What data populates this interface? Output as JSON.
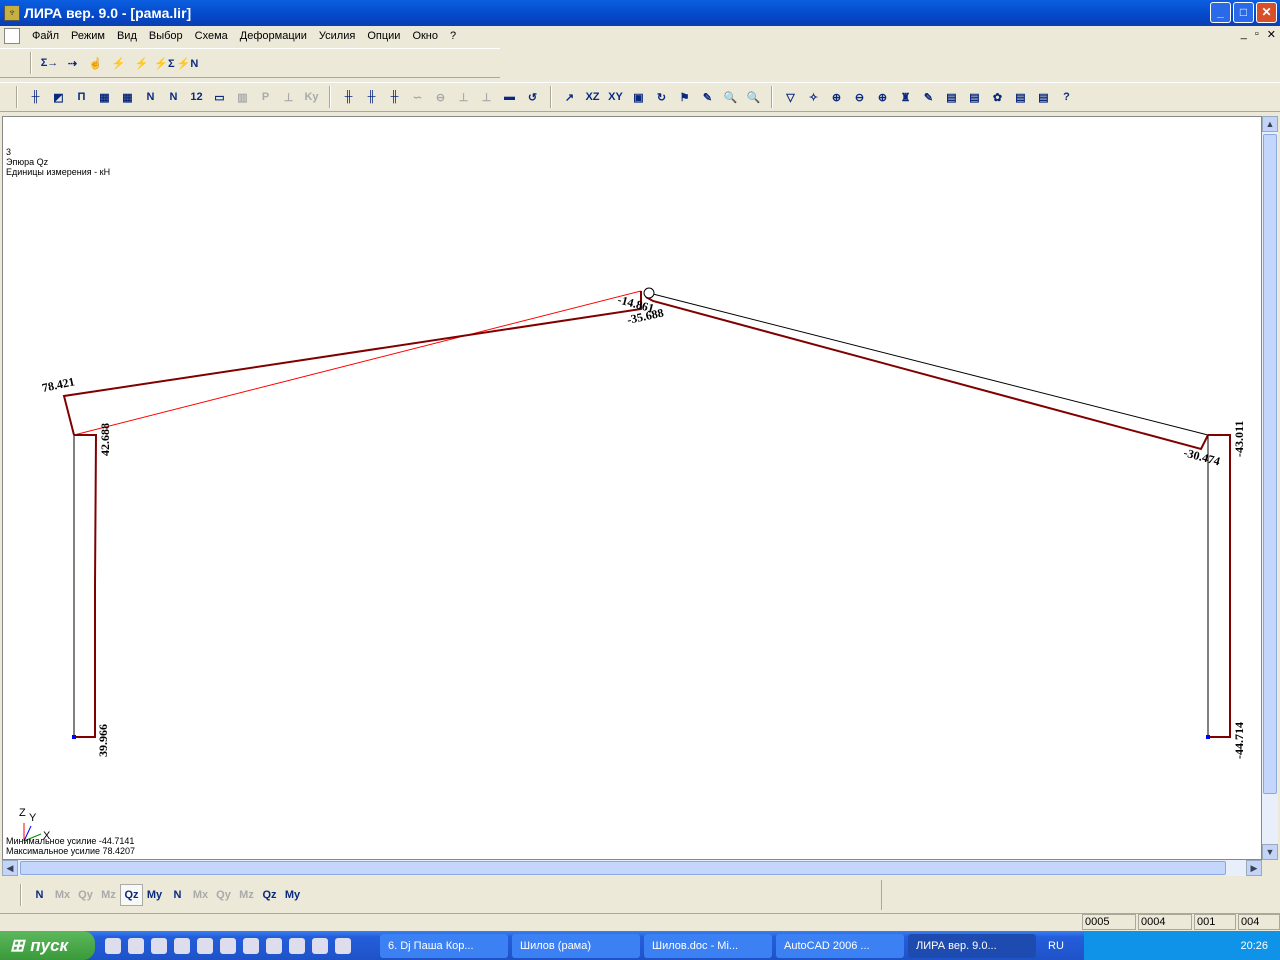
{
  "window": {
    "title": "ЛИРА  вер. 9.0 - [рама.lir]",
    "minimize": "_",
    "maximize": "□",
    "close": "✕"
  },
  "menu": [
    "Файл",
    "Режим",
    "Вид",
    "Выбор",
    "Схема",
    "Деформации",
    "Усилия",
    "Опции",
    "Окно",
    "?"
  ],
  "toolbar1": [
    "Σ→",
    "⇢",
    "☝",
    "⚡",
    "⚡",
    "⚡Σ",
    "⚡N"
  ],
  "toolbar2": [
    "╫",
    "◩",
    "Π",
    "▦",
    "▦",
    "N",
    "N",
    "12",
    "▭",
    "▥",
    "P",
    "⊥",
    "Ky"
  ],
  "toolbar3": [
    "╫",
    "╫",
    "╫",
    "∽",
    "⊖",
    "⊥",
    "⊥",
    "▬",
    "↺"
  ],
  "toolbar4": [
    "↗",
    "XZ",
    "XY",
    "▣",
    "↻",
    "⚑",
    "✎",
    "🔍",
    "🔍"
  ],
  "toolbar5": [
    "▽",
    "✧",
    "⊕",
    "⊖",
    "⊕",
    "♜",
    "✎",
    "▤",
    "▤",
    "✿",
    "▤",
    "▤",
    "?"
  ],
  "canvas": {
    "info": [
      "3",
      "Эпюра Qz",
      "Единицы измерения - кН"
    ],
    "labels": {
      "left_rafter_start": "78.421",
      "left_col_top": "42.688",
      "left_col_bottom": "39.966",
      "apex_a": "-14.861",
      "apex_b": "-35.688",
      "right_rafter_end": "-30.474",
      "right_col_top": "-43.011",
      "right_col_bottom": "-44.714"
    },
    "axes": {
      "z": "Z",
      "y": "Y",
      "x": "X"
    },
    "min_label": "Минимальное усилие  -44.7141",
    "max_label": "Максимальное усилие  78.4207",
    "colors": {
      "diagram": "#800000",
      "axis_red": "#ff0000",
      "frame": "#000000"
    }
  },
  "force_buttons": [
    {
      "label": "N",
      "enabled": true
    },
    {
      "label": "Mx",
      "enabled": false
    },
    {
      "label": "Qy",
      "enabled": false
    },
    {
      "label": "Mz",
      "enabled": false
    },
    {
      "label": "Qz",
      "enabled": true,
      "active": true
    },
    {
      "label": "My",
      "enabled": true
    },
    {
      "label": "N",
      "enabled": true
    },
    {
      "label": "Mx",
      "enabled": false
    },
    {
      "label": "Qy",
      "enabled": false
    },
    {
      "label": "Mz",
      "enabled": false
    },
    {
      "label": "Qz",
      "enabled": true
    },
    {
      "label": "My",
      "enabled": true
    }
  ],
  "status": [
    "0005",
    "0004",
    "001",
    "004"
  ],
  "taskbar": {
    "start": "пуск",
    "tasks": [
      "6. Dj Паша Кор...",
      "Шилов (рама)",
      "Шилов.doc - Mi...",
      "AutoCAD 2006 ...",
      "ЛИРА  вер. 9.0..."
    ],
    "active_task": 4,
    "lang": "RU",
    "clock": "20:26"
  }
}
